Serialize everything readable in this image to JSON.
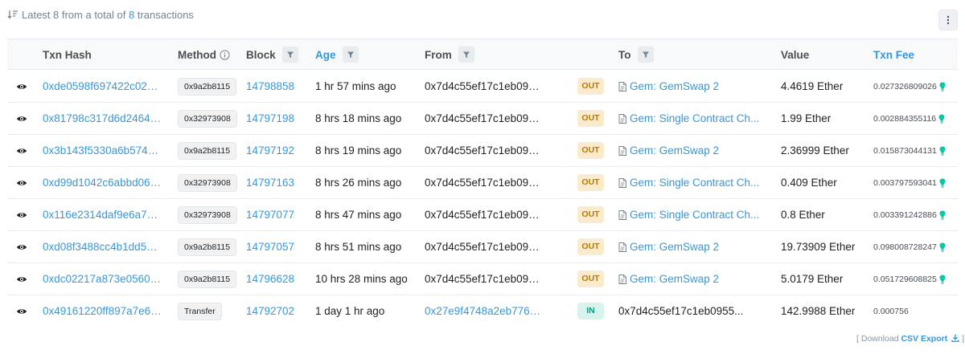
{
  "summary": {
    "prefix": "Latest 8 from a total of",
    "count": "8",
    "suffix": "transactions"
  },
  "columns": {
    "txn_hash": "Txn Hash",
    "method": "Method",
    "block": "Block",
    "age": "Age",
    "from": "From",
    "to": "To",
    "value": "Value",
    "txn_fee": "Txn Fee"
  },
  "rows": [
    {
      "hash": "0xde0598f697422c021c...",
      "method": "0x9a2b8115",
      "block": "14798858",
      "age": "1 hr 57 mins ago",
      "from": "0x7d4c55ef17c1eb0955...",
      "direction": "OUT",
      "to": "Gem: GemSwap 2",
      "value": "4.4619 Ether",
      "fee": "0.027326809026"
    },
    {
      "hash": "0x81798c317d6d2464a9...",
      "method": "0x32973908",
      "block": "14797198",
      "age": "8 hrs 18 mins ago",
      "from": "0x7d4c55ef17c1eb0955...",
      "direction": "OUT",
      "to": "Gem: Single Contract Ch...",
      "value": "1.99 Ether",
      "fee": "0.002884355116"
    },
    {
      "hash": "0x3b143f5330a6b57480...",
      "method": "0x9a2b8115",
      "block": "14797192",
      "age": "8 hrs 19 mins ago",
      "from": "0x7d4c55ef17c1eb0955...",
      "direction": "OUT",
      "to": "Gem: GemSwap 2",
      "value": "2.36999 Ether",
      "fee": "0.015873044131"
    },
    {
      "hash": "0xd99d1042c6abbd062a...",
      "method": "0x32973908",
      "block": "14797163",
      "age": "8 hrs 26 mins ago",
      "from": "0x7d4c55ef17c1eb0955...",
      "direction": "OUT",
      "to": "Gem: Single Contract Ch...",
      "value": "0.409 Ether",
      "fee": "0.003797593041"
    },
    {
      "hash": "0x116e2314daf9e6a769...",
      "method": "0x32973908",
      "block": "14797077",
      "age": "8 hrs 47 mins ago",
      "from": "0x7d4c55ef17c1eb0955...",
      "direction": "OUT",
      "to": "Gem: Single Contract Ch...",
      "value": "0.8 Ether",
      "fee": "0.003391242886"
    },
    {
      "hash": "0xd08f3488cc4b1dd58f2...",
      "method": "0x9a2b8115",
      "block": "14797057",
      "age": "8 hrs 51 mins ago",
      "from": "0x7d4c55ef17c1eb0955...",
      "direction": "OUT",
      "to": "Gem: GemSwap 2",
      "value": "19.73909 Ether",
      "fee": "0.098008728247"
    },
    {
      "hash": "0xdc02217a873e0560f5...",
      "method": "0x9a2b8115",
      "block": "14796628",
      "age": "10 hrs 28 mins ago",
      "from": "0x7d4c55ef17c1eb0955...",
      "direction": "OUT",
      "to": "Gem: GemSwap 2",
      "value": "5.0179 Ether",
      "fee": "0.051729608825"
    },
    {
      "hash": "0x49161220ff897a7e648...",
      "method": "Transfer",
      "block": "14792702",
      "age": "1 day 1 hr ago",
      "from": "0x27e9f4748a2eb776be...",
      "direction": "IN",
      "to": "0x7d4c55ef17c1eb0955...",
      "value": "142.9988 Ether",
      "fee": "0.000756"
    }
  ],
  "footer": {
    "open": "[ Download",
    "csv": "CSV Export",
    "close": "]"
  },
  "colors": {
    "link": "#3498db",
    "out_badge_bg": "#fbeacc",
    "out_badge_text": "#b47d00",
    "in_badge_bg": "#d6f3ec",
    "in_badge_text": "#00a186",
    "fee_bulb": "#00c9a7"
  },
  "icons": {
    "sort": "sort-descending-icon",
    "more": "more-vertical-icon",
    "info": "info-icon",
    "filter": "filter-icon",
    "view": "eye-icon",
    "contract": "contract-document-icon",
    "fee_indicator": "lightbulb-icon",
    "download": "download-icon"
  }
}
